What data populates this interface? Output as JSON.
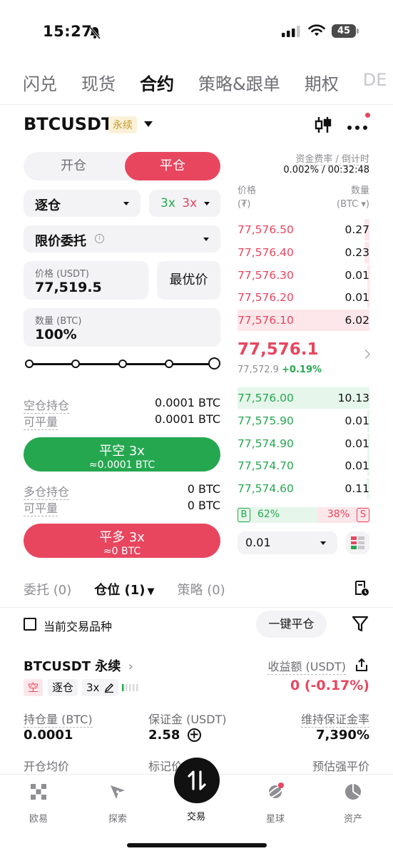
{
  "status": {
    "time": "15:27",
    "battery": "45"
  },
  "topnav": [
    "闪兑",
    "现货",
    "合约",
    "策略&跟单",
    "期权",
    "DE"
  ],
  "header": {
    "pair": "BTCUSDT",
    "tag": "永续"
  },
  "toggle": {
    "open": "开仓",
    "close": "平仓"
  },
  "funding": {
    "label": "资金费率 / 倒计时",
    "value": "0.002% / 00:32:48"
  },
  "form": {
    "margin_mode": "逐仓",
    "lev_long": "3x",
    "lev_short": "3x",
    "order_type": "限价委托",
    "price_label": "价格 (USDT)",
    "price_value": "77,519.5",
    "best_price": "最优价",
    "qty_label": "数量 (BTC)",
    "qty_value": "100%",
    "slider_percent": 100
  },
  "short_pos": {
    "held_label": "空仓持仓",
    "held_value": "0.0001 BTC",
    "avail_label": "可平量",
    "avail_value": "0.0001 BTC",
    "button_l1": "平空 3x",
    "button_l2": "≈0.0001 BTC"
  },
  "long_pos": {
    "held_label": "多仓持仓",
    "held_value": "0 BTC",
    "avail_label": "可平量",
    "avail_value": "0 BTC",
    "button_l1": "平多 3x",
    "button_l2": "≈0 BTC"
  },
  "orderbook": {
    "price_label": "价格",
    "price_unit": "(₮)",
    "qty_label": "数量",
    "qty_unit": "(BTC ▾)",
    "asks": [
      {
        "price": "77,576.50",
        "qty": "0.27",
        "depth": 0.04
      },
      {
        "price": "77,576.40",
        "qty": "0.23",
        "depth": 0.04
      },
      {
        "price": "77,576.30",
        "qty": "0.01",
        "depth": 0.01
      },
      {
        "price": "77,576.20",
        "qty": "0.01",
        "depth": 0.01
      },
      {
        "price": "77,576.10",
        "qty": "6.02",
        "depth": 1.0
      }
    ],
    "mid_price": "77,576.1",
    "mark_price": "77,572.9",
    "change": "+0.19%",
    "bids": [
      {
        "price": "77,576.00",
        "qty": "10.13",
        "depth": 1.0
      },
      {
        "price": "77,575.90",
        "qty": "0.01",
        "depth": 0.01
      },
      {
        "price": "77,574.90",
        "qty": "0.01",
        "depth": 0.01
      },
      {
        "price": "77,574.70",
        "qty": "0.01",
        "depth": 0.01
      },
      {
        "price": "77,574.60",
        "qty": "0.11",
        "depth": 0.02
      }
    ],
    "buy_tag": "B",
    "buy_ratio": "62%",
    "sell_tag": "S",
    "sell_ratio": "38%",
    "precision": "0.01"
  },
  "pos_tabs": [
    "委托 (0)",
    "仓位 (1)",
    "策略 (0)"
  ],
  "filter": {
    "current_only": "当前交易品种",
    "close_all": "一键平仓"
  },
  "position": {
    "title": "BTCUSDT 永续",
    "side": "空",
    "mode": "逐仓",
    "leverage": "3x",
    "pnl_label": "收益额 (USDT)",
    "pnl_value": "0 (-0.17%)",
    "size_label": "持仓量 (BTC)",
    "size_value": "0.0001",
    "margin_label": "保证金 (USDT)",
    "margin_value": "2.58",
    "mmr_label": "维持保证金率",
    "mmr_value": "7,390%",
    "entry_label": "开仓均价",
    "mark_label": "标记价格",
    "liq_label": "预估强平价"
  },
  "bottomnav": [
    "欧易",
    "探索",
    "交易",
    "星球",
    "资产"
  ],
  "colors": {
    "green": "#25a750",
    "red": "#e8465f"
  }
}
